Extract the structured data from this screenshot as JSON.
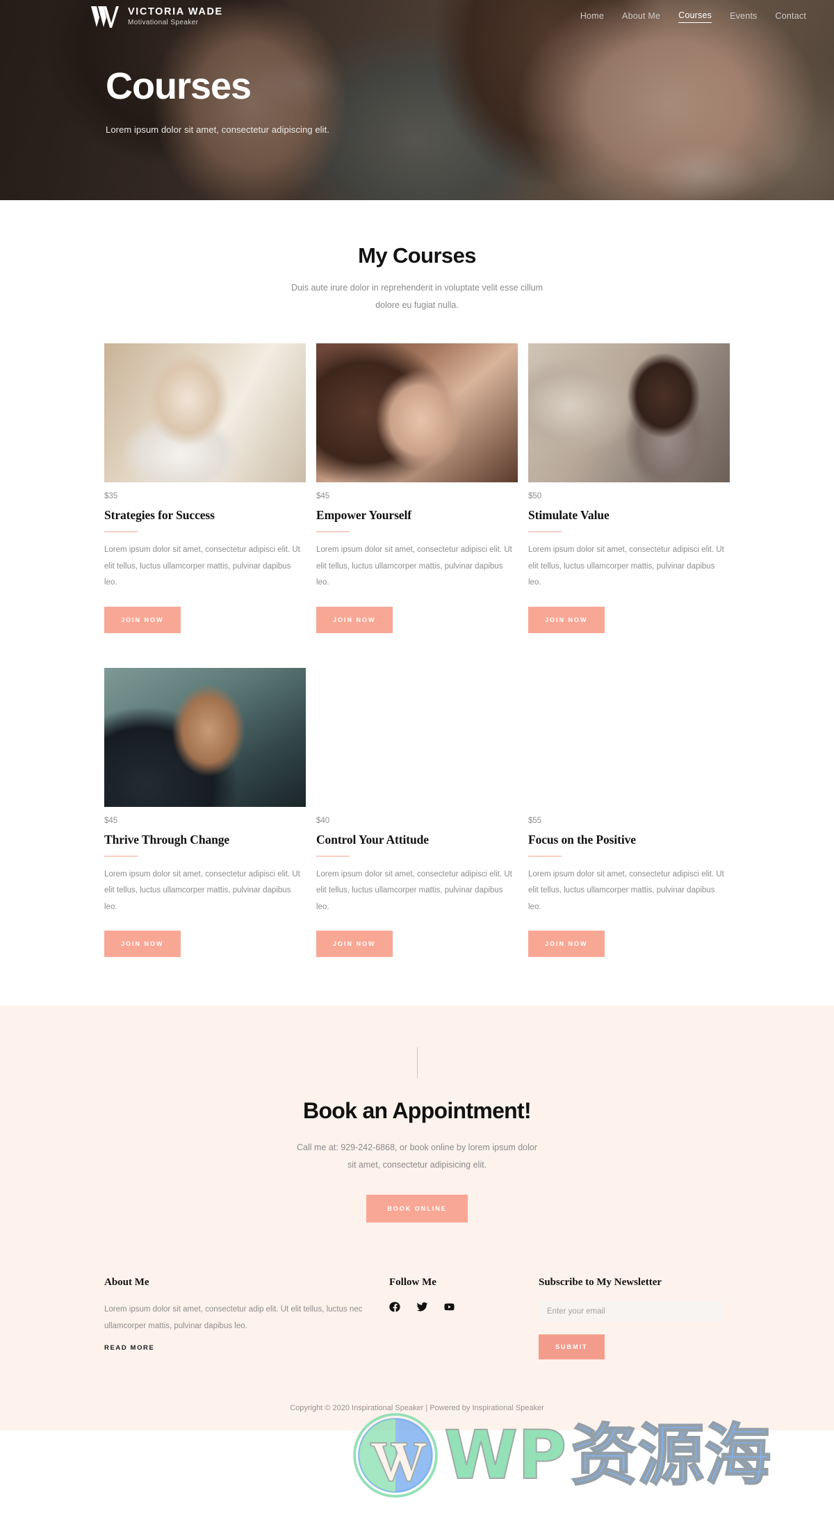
{
  "brand": {
    "name": "VICTORIA WADE",
    "tagline": "Motivational Speaker",
    "logo_icon": "vw-monogram-icon"
  },
  "nav": {
    "items": [
      {
        "label": "Home",
        "active": false
      },
      {
        "label": "About Me",
        "active": false
      },
      {
        "label": "Courses",
        "active": true
      },
      {
        "label": "Events",
        "active": false
      },
      {
        "label": "Contact",
        "active": false
      }
    ]
  },
  "hero": {
    "title": "Courses",
    "subtitle": "Lorem ipsum dolor sit amet, consectetur adipiscing elit."
  },
  "courses_section": {
    "title": "My Courses",
    "subtitle": "Duis aute irure dolor in reprehenderit in voluptate velit esse cillum dolore eu fugiat nulla.",
    "cards": [
      {
        "price": "$35",
        "title": "Strategies for Success",
        "description": "Lorem ipsum dolor sit amet, consectetur adipisci elit. Ut elit tellus, luctus  ullamcorper mattis, pulvinar dapibus leo.",
        "button": "JOIN NOW",
        "image": "woman-at-laptop-photo"
      },
      {
        "price": "$45",
        "title": "Empower Yourself",
        "description": "Lorem ipsum dolor sit amet, consectetur adipisci elit. Ut elit tellus, luctus  ullamcorper mattis, pulvinar dapibus leo.",
        "button": "JOIN NOW",
        "image": "woman-windblown-hair-photo"
      },
      {
        "price": "$50",
        "title": "Stimulate Value",
        "description": "Lorem ipsum dolor sit amet, consectetur adipisci elit. Ut elit tellus, luctus  ullamcorper mattis, pulvinar dapibus leo.",
        "button": "JOIN NOW",
        "image": "woman-glasses-office-photo"
      },
      {
        "price": "$45",
        "title": "Thrive Through Change",
        "description": "Lorem ipsum dolor sit amet, consectetur adipisci elit. Ut elit tellus, luctus  ullamcorper mattis, pulvinar dapibus leo.",
        "button": "JOIN NOW",
        "image": "man-profile-portrait-photo"
      },
      {
        "price": "$40",
        "title": "Control Your Attitude",
        "description": "Lorem ipsum dolor sit amet, consectetur adipisci elit. Ut elit tellus, luctus  ullamcorper mattis, pulvinar dapibus leo.",
        "button": "JOIN NOW",
        "image": "angry-man-at-desk-photo"
      },
      {
        "price": "$55",
        "title": "Focus on the Positive",
        "description": "Lorem ipsum dolor sit amet, consectetur adipisci elit. Ut elit tellus, luctus  ullamcorper mattis, pulvinar dapibus leo.",
        "button": "JOIN NOW",
        "image": "woman-writing-notes-photo"
      }
    ]
  },
  "appointment": {
    "title": "Book an Appointment!",
    "subtitle": "Call me at: 929-242-6868, or book online by lorem ipsum dolor sit amet, consectetur adipisicing elit.",
    "button": "BOOK ONLINE"
  },
  "footer": {
    "about": {
      "heading": "About Me",
      "text": "Lorem ipsum dolor sit amet, consectetur adip elit. Ut elit tellus, luctus nec ullamcorper mattis, pulvinar dapibus leo.",
      "link": "READ MORE"
    },
    "follow": {
      "heading": "Follow Me",
      "socials": [
        {
          "name": "facebook-icon"
        },
        {
          "name": "twitter-icon"
        },
        {
          "name": "youtube-icon"
        }
      ]
    },
    "newsletter": {
      "heading": "Subscribe to My Newsletter",
      "placeholder": "Enter your email",
      "value": "",
      "button": "SUBMIT"
    },
    "copyright": "Copyright © 2020 Inspirational Speaker | Powered by Inspirational Speaker"
  },
  "watermark": {
    "latin": "WP",
    "cjk": "资源海",
    "logo": "wordpress-logo-icon"
  },
  "colors": {
    "accent": "#f9a795",
    "accent_dark": "#f49c8c",
    "rule": "#f8cec4",
    "cream": "#fdf2ec",
    "muted_text": "#8d8d8d",
    "heading": "#111111"
  }
}
